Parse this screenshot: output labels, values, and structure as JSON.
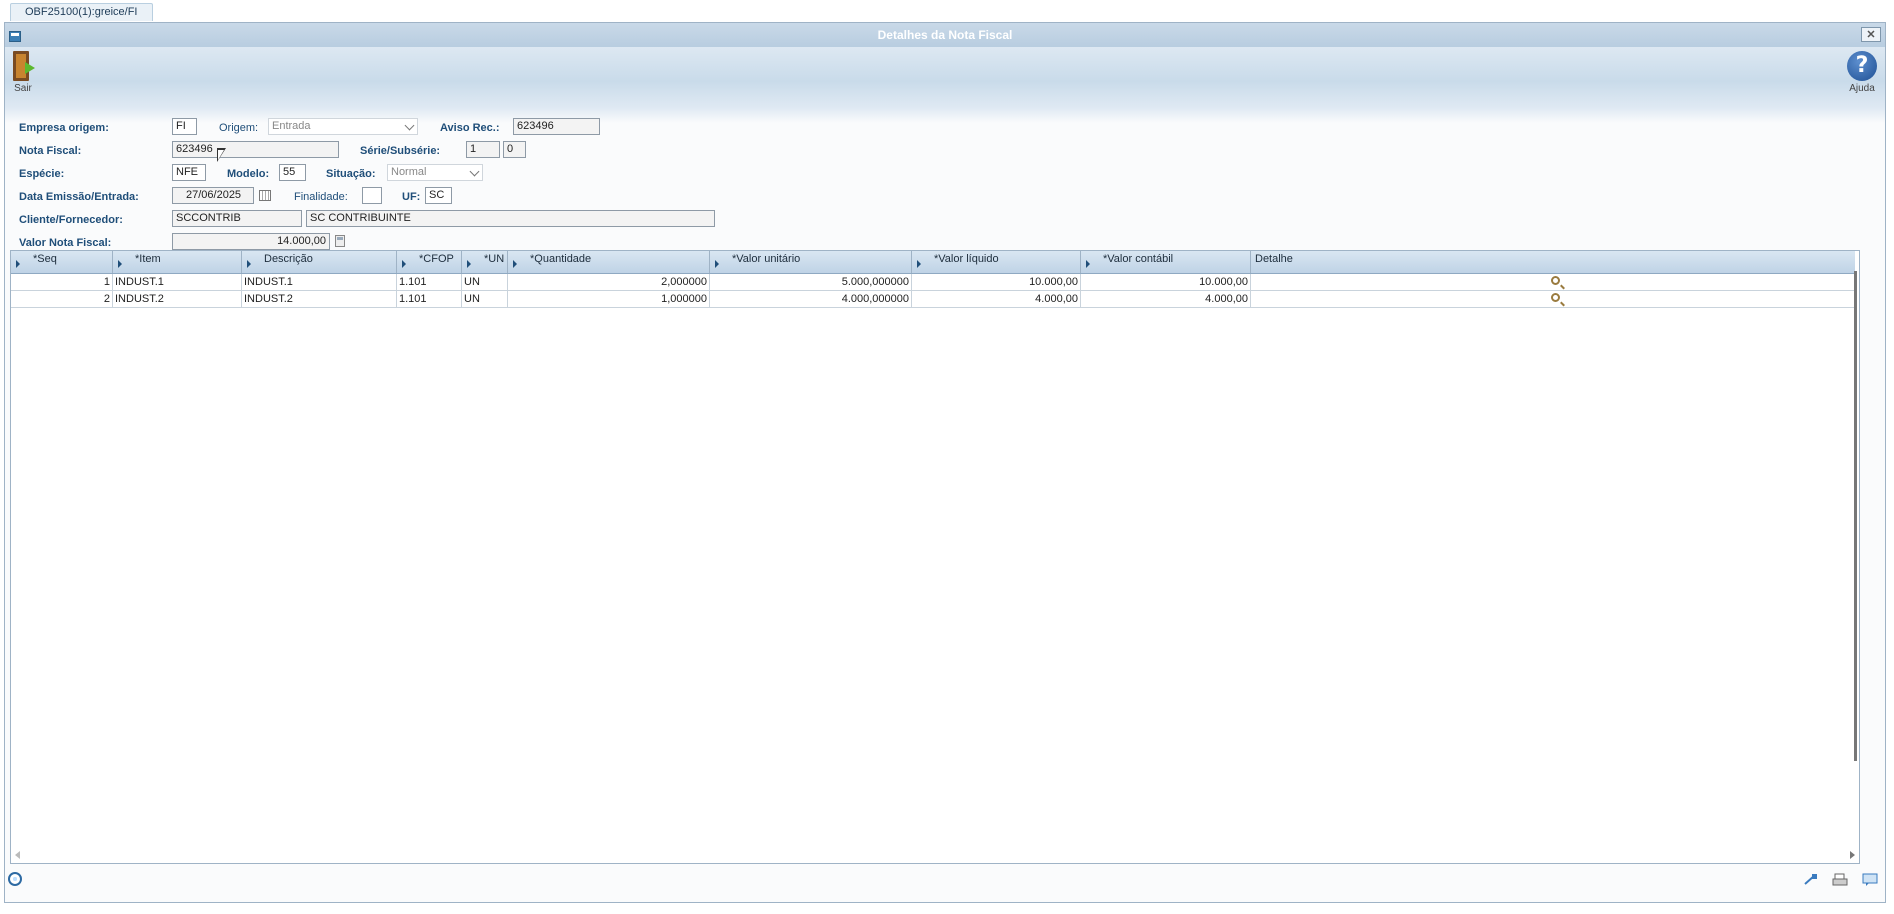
{
  "tab": {
    "label": "OBF25100(1):greice/FI"
  },
  "window": {
    "title": "Detalhes da Nota Fiscal",
    "close_label": "✕"
  },
  "toolbar": {
    "exit_label": "Sair",
    "help_label": "Ajuda",
    "help_glyph": "?"
  },
  "form": {
    "empresa_origem_label": "Empresa origem:",
    "empresa_origem_value": "FI",
    "origem_label": "Origem:",
    "origem_value": "Entrada",
    "aviso_rec_label": "Aviso Rec.:",
    "aviso_rec_value": "623496",
    "nota_fiscal_label": "Nota Fiscal:",
    "nota_fiscal_value": "623496",
    "serie_label": "Série/Subsérie:",
    "serie_value": "1",
    "subserie_value": "0",
    "especie_label": "Espécie:",
    "especie_value": "NFE",
    "modelo_label": "Modelo:",
    "modelo_value": "55",
    "situacao_label": "Situação:",
    "situacao_value": "Normal",
    "data_label": "Data Emissão/Entrada:",
    "data_value": "27/06/2025",
    "finalidade_label": "Finalidade:",
    "finalidade_value": "",
    "uf_label": "UF:",
    "uf_value": "SC",
    "cliente_label": "Cliente/Fornecedor:",
    "cliente_code": "SCCONTRIB",
    "cliente_name": "SC CONTRIBUINTE",
    "valor_label": "Valor Nota Fiscal:",
    "valor_value": "14.000,00"
  },
  "grid": {
    "columns": [
      "*Seq",
      "*Item",
      "Descrição",
      "*CFOP",
      "*UN",
      "*Quantidade",
      "*Valor unitário",
      "*Valor líquido",
      "*Valor contábil",
      "Detalhe"
    ],
    "rows": [
      {
        "seq": "1",
        "item": "INDUST.1",
        "descricao": "INDUST.1",
        "cfop": "1.101",
        "un": "UN",
        "quantidade": "2,000000",
        "valor_unitario": "5.000,000000",
        "valor_liquido": "10.000,00",
        "valor_contabil": "10.000,00"
      },
      {
        "seq": "2",
        "item": "INDUST.2",
        "descricao": "INDUST.2",
        "cfop": "1.101",
        "un": "UN",
        "quantidade": "1,000000",
        "valor_unitario": "4.000,000000",
        "valor_liquido": "4.000,00",
        "valor_contabil": "4.000,00"
      }
    ]
  },
  "icons": {
    "exit": "door-exit-icon",
    "help": "help-icon",
    "calendar": "calendar-icon",
    "calculator": "calculator-icon",
    "detail": "magnifier-icon",
    "status": "status-icon"
  }
}
